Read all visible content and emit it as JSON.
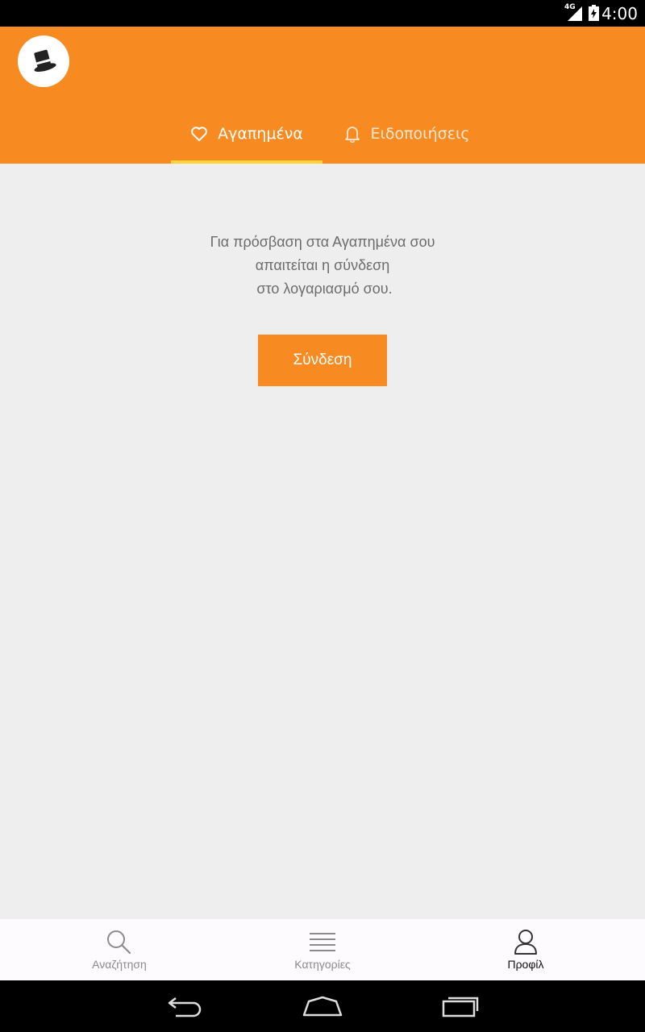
{
  "status_bar": {
    "time": "4:00",
    "network": "4G"
  },
  "tabs": [
    {
      "label": "Αγαπημένα",
      "icon": "heart-icon",
      "active": true
    },
    {
      "label": "Ειδοποιήσεις",
      "icon": "bell-icon",
      "active": false
    }
  ],
  "main": {
    "message_lines": [
      "Για πρόσβαση στα Αγαπημένα σου",
      "απαιτείται η σύνδεση",
      " στο λογαριασμό σου."
    ],
    "login_label": "Σύνδεση"
  },
  "bottom_nav": [
    {
      "label": "Αναζήτηση",
      "icon": "search-icon",
      "active": false
    },
    {
      "label": "Κατηγορίες",
      "icon": "list-icon",
      "active": false
    },
    {
      "label": "Προφίλ",
      "icon": "profile-icon",
      "active": true
    }
  ],
  "colors": {
    "brand": "#f78b22",
    "tab_indicator": "#ffd23c",
    "background": "#eeeeee"
  }
}
